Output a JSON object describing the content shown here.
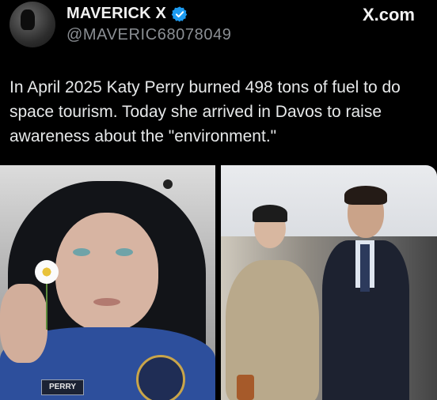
{
  "author": {
    "display_name": "MAVERICK X",
    "handle": "@MAVERIC68078049",
    "verified": true
  },
  "watermark": "X.com",
  "tweet": {
    "text": "In April 2025 Katy Perry burned 498 tons of fuel to do space tourism. Today she arrived in Davos to raise awareness about the \"environment.\""
  },
  "media": {
    "left_photo": {
      "name_tag": "PERRY"
    }
  },
  "colors": {
    "background": "#000000",
    "text_primary": "#e7e9ea",
    "text_secondary": "#8b8f94",
    "verified_badge": "#1d9bf0"
  },
  "icons": {
    "verified": "verified-badge-icon"
  }
}
